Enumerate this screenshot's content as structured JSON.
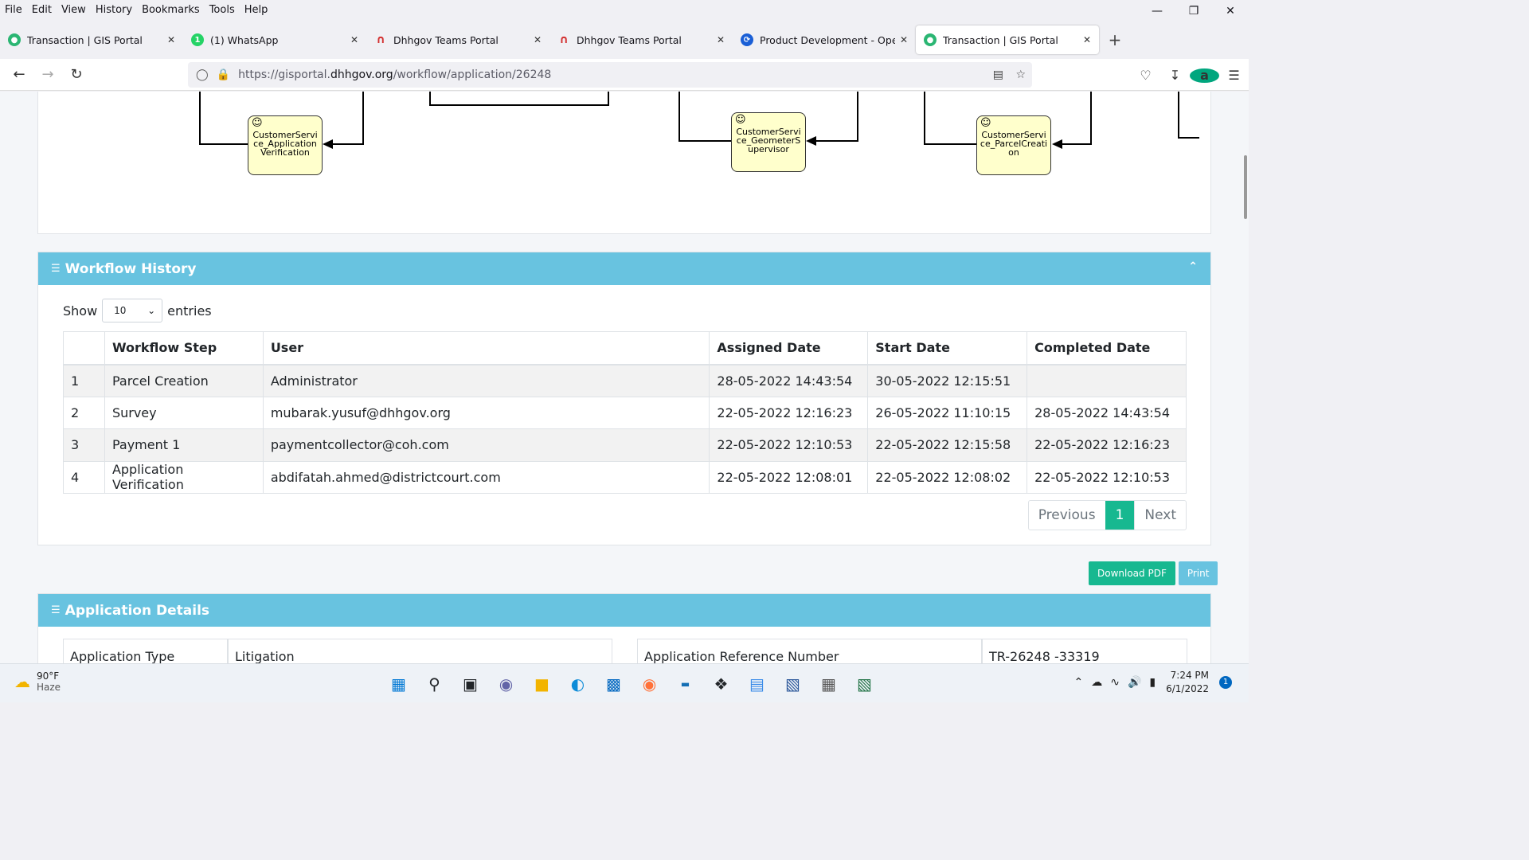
{
  "menu": [
    "File",
    "Edit",
    "View",
    "History",
    "Bookmarks",
    "Tools",
    "Help"
  ],
  "tabs": [
    {
      "title": "Transaction | GIS Portal",
      "active": false
    },
    {
      "title": "(1) WhatsApp",
      "active": false
    },
    {
      "title": "Dhhgov Teams Portal",
      "active": false
    },
    {
      "title": "Dhhgov Teams Portal",
      "active": false
    },
    {
      "title": "Product Development - Operati",
      "active": false
    },
    {
      "title": "Transaction | GIS Portal",
      "active": true
    }
  ],
  "url": {
    "prefix": "https://gisportal.",
    "host": "dhhgov.org",
    "path": "/workflow/application/26248"
  },
  "diagram": {
    "nodes": [
      "CustomerServi ce_Application Verification",
      "CustomerServi ce_GeometerS upervisor",
      "CustomerServi ce_ParcelCreati on"
    ]
  },
  "workflow": {
    "title": "Workflow History",
    "show_label": "Show",
    "entries_label": "entries",
    "page_size": "10",
    "columns": [
      "",
      "Workflow Step",
      "User",
      "Assigned Date",
      "Start Date",
      "Completed Date"
    ],
    "rows": [
      [
        "1",
        "Parcel Creation",
        "Administrator",
        "28-05-2022 14:43:54",
        "30-05-2022 12:15:51",
        ""
      ],
      [
        "2",
        "Survey",
        "mubarak.yusuf@dhhgov.org",
        "22-05-2022 12:16:23",
        "26-05-2022 11:10:15",
        "28-05-2022 14:43:54"
      ],
      [
        "3",
        "Payment 1",
        "paymentcollector@coh.com",
        "22-05-2022 12:10:53",
        "22-05-2022 12:15:58",
        "22-05-2022 12:16:23"
      ],
      [
        "4",
        "Application Verification",
        "abdifatah.ahmed@districtcourt.com",
        "22-05-2022 12:08:01",
        "22-05-2022 12:08:02",
        "22-05-2022 12:10:53"
      ]
    ],
    "pager": {
      "previous": "Previous",
      "current": "1",
      "next": "Next"
    }
  },
  "buttons": {
    "download_pdf": "Download PDF",
    "print": "Print"
  },
  "app_details": {
    "title": "Application Details",
    "type_label": "Application Type",
    "type_value": "Litigation",
    "ref_label": "Application Reference Number",
    "ref_value": "TR-26248 -33319"
  },
  "taskbar": {
    "temp": "90°F",
    "weather": "Haze",
    "time": "7:24 PM",
    "date": "6/1/2022",
    "notifications": "1"
  }
}
